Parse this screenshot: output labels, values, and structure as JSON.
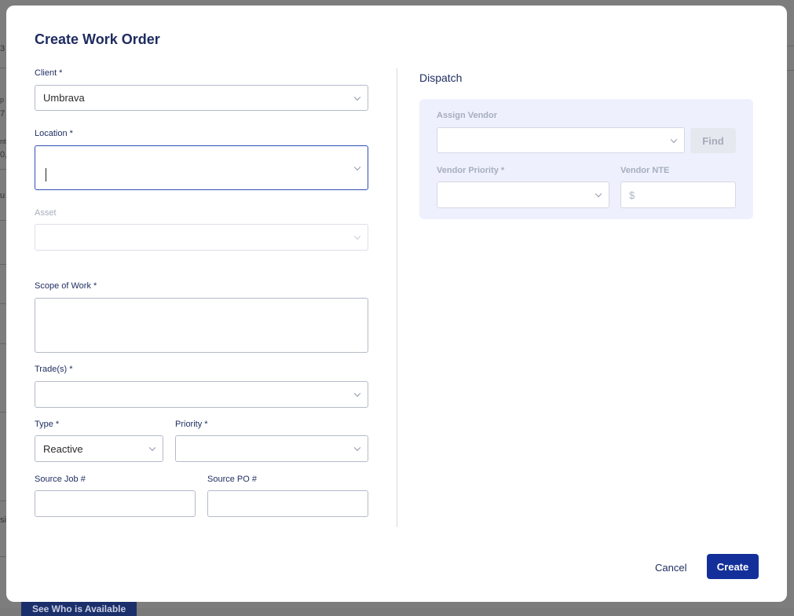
{
  "background": {
    "button_label": "See Who is Available",
    "cut_texts": [
      "3",
      "p",
      "7",
      "nt",
      "0,",
      "u",
      "sit"
    ]
  },
  "modal": {
    "title": "Create Work Order",
    "client": {
      "label": "Client *",
      "value": "Umbrava"
    },
    "location": {
      "label": "Location *",
      "value": ""
    },
    "asset": {
      "label": "Asset",
      "value": ""
    },
    "scope": {
      "label": "Scope of Work *",
      "value": ""
    },
    "trades": {
      "label": "Trade(s) *",
      "value": ""
    },
    "type": {
      "label": "Type *",
      "value": "Reactive"
    },
    "priority": {
      "label": "Priority *",
      "value": ""
    },
    "source_job": {
      "label": "Source Job #",
      "value": ""
    },
    "source_po": {
      "label": "Source PO #",
      "value": ""
    },
    "dispatch": {
      "title": "Dispatch",
      "assign_vendor": {
        "label": "Assign Vendor",
        "value": ""
      },
      "find_label": "Find",
      "vendor_priority": {
        "label": "Vendor Priority *",
        "value": ""
      },
      "vendor_nte": {
        "label": "Vendor NTE",
        "prefix": "$"
      }
    },
    "cancel_label": "Cancel",
    "create_label": "Create"
  },
  "colors": {
    "primary": "#13309a",
    "heading": "#1d2b5f",
    "dispatch_panel": "#eef1fd"
  }
}
